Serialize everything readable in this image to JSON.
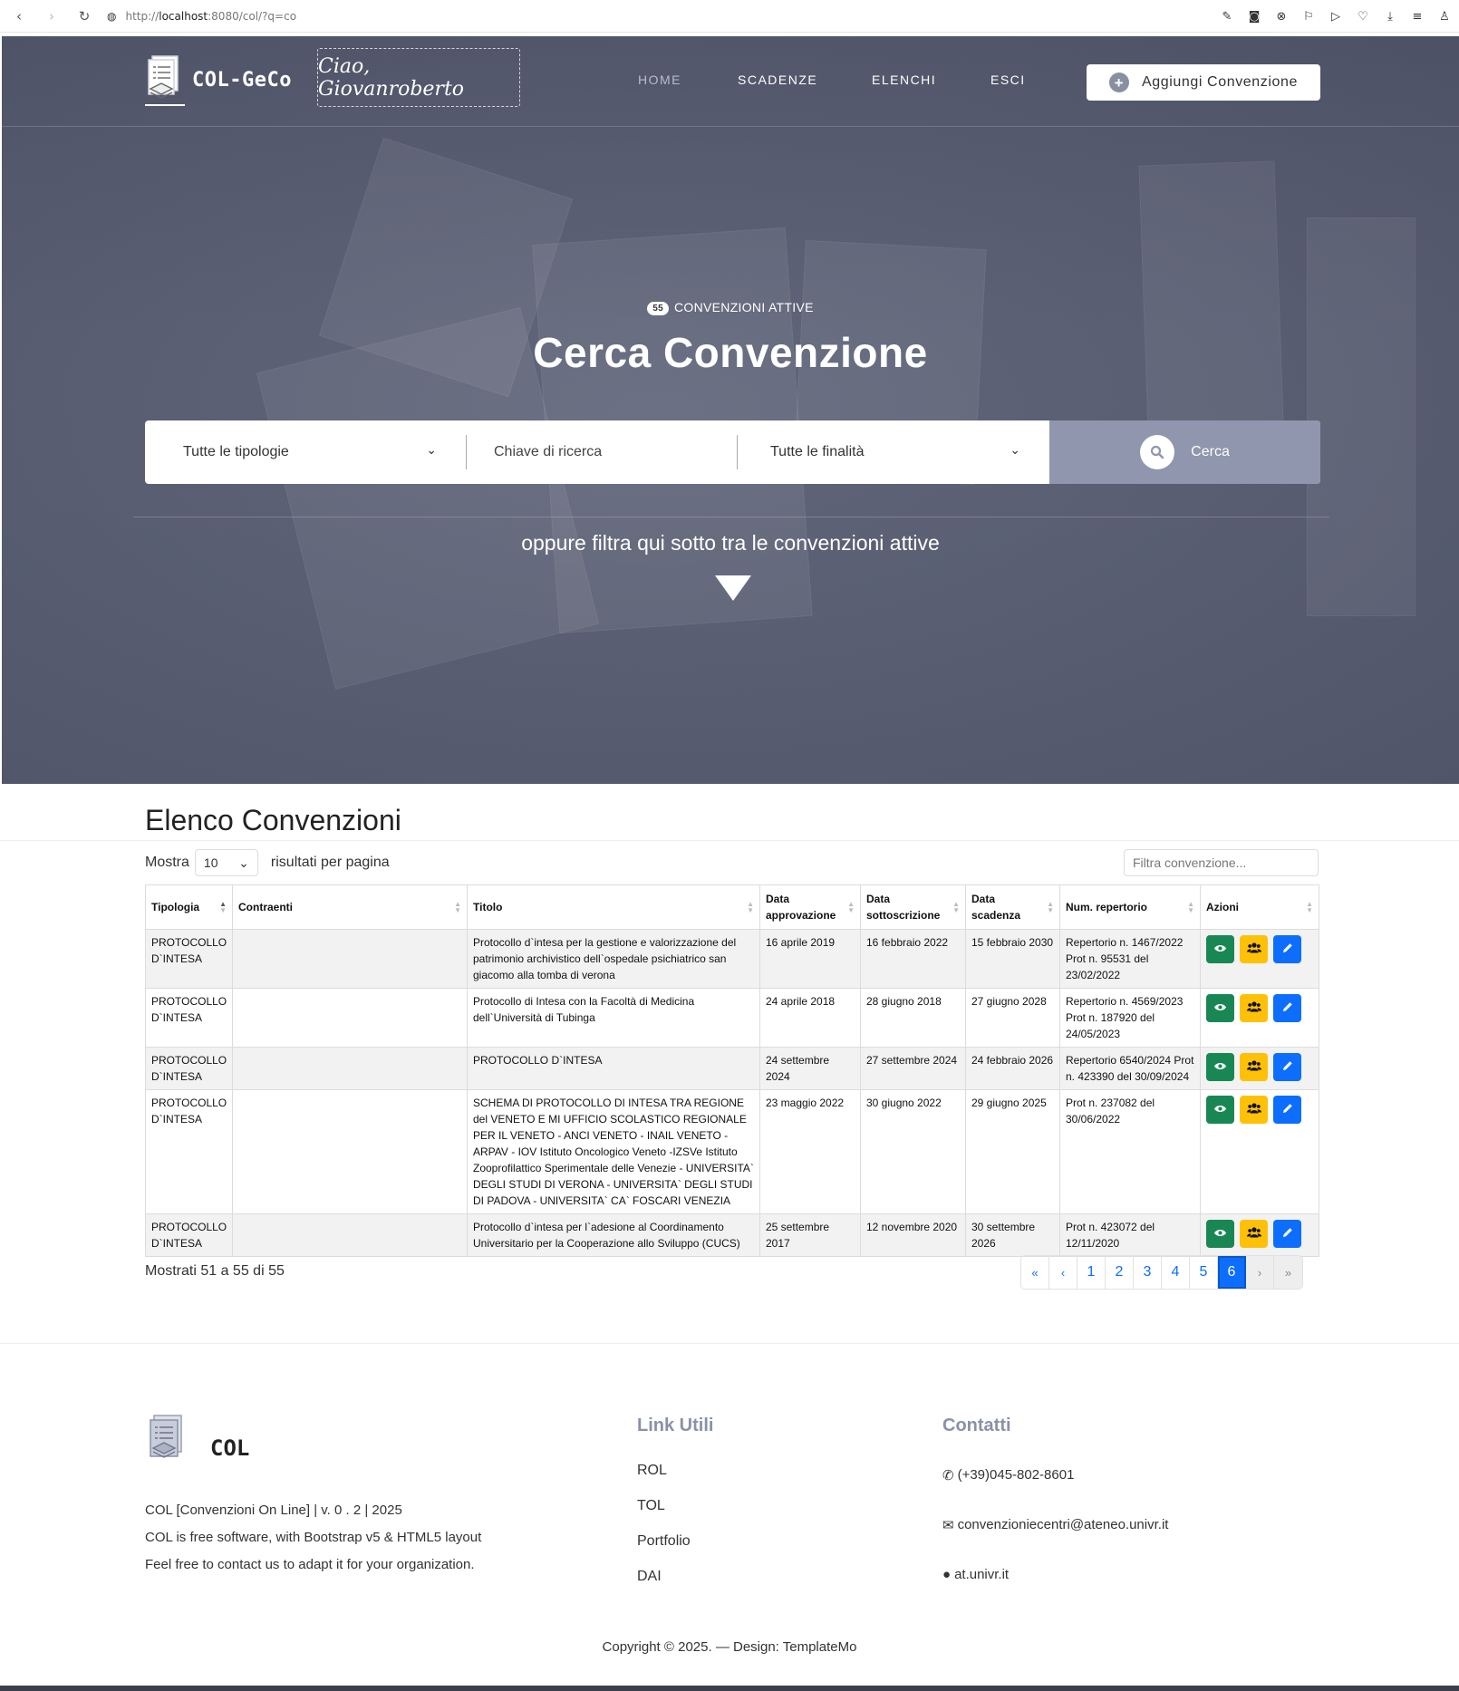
{
  "browser": {
    "url_prefix": "http://",
    "url_host": "localhost",
    "url_rest": ":8080/col/?q=co",
    "icons": [
      "back-icon",
      "forward-icon",
      "reload-icon",
      "site-info-icon"
    ]
  },
  "header": {
    "logo_text": "COL-GeCo",
    "greeting": "Ciao, Giovanroberto",
    "menu": [
      {
        "label": "HOME",
        "active": true
      },
      {
        "label": "SCADENZE",
        "active": false
      },
      {
        "label": "ELENCHI",
        "active": false
      },
      {
        "label": "ESCI",
        "active": false
      }
    ],
    "add_button": "Aggiungi Convenzione"
  },
  "hero": {
    "active_count": "55",
    "active_label": "CONVENZIONI ATTIVE",
    "title": "Cerca Convenzione",
    "search": {
      "type_select": "Tutte le tipologie",
      "keyword_placeholder": "Chiave di ricerca",
      "purpose_select": "Tutte le finalità",
      "button": "Cerca"
    },
    "subtitle": "oppure filtra qui sotto tra le convenzioni attive"
  },
  "list": {
    "title": "Elenco Convenzioni",
    "show_label": "Mostra",
    "page_length": "10",
    "per_page_label": "risultati per pagina",
    "filter_placeholder": "Filtra convenzione...",
    "columns": [
      "Tipologia",
      "Contraenti",
      "Titolo",
      "Data approvazione",
      "Data sottoscrizione",
      "Data scadenza",
      "Num. repertorio",
      "Azioni"
    ],
    "rows": [
      {
        "tipologia": "PROTOCOLLO D`INTESA",
        "contraenti": "",
        "titolo": "Protocollo d`intesa per la gestione e valorizzazione del patrimonio archivistico dell`ospedale psichiatrico san giacomo alla tomba di verona",
        "approvazione": "16 aprile 2019",
        "sottoscrizione": "16 febbraio 2022",
        "scadenza": "15 febbraio 2030",
        "repertorio": "Repertorio n. 1467/2022 Prot n. 95531 del 23/02/2022"
      },
      {
        "tipologia": "PROTOCOLLO D`INTESA",
        "contraenti": "",
        "titolo": "Protocollo di Intesa con la Facoltà di Medicina dell`Università di Tubinga",
        "approvazione": "24 aprile 2018",
        "sottoscrizione": "28 giugno 2018",
        "scadenza": "27 giugno 2028",
        "repertorio": "Repertorio n. 4569/2023 Prot n. 187920 del 24/05/2023"
      },
      {
        "tipologia": "PROTOCOLLO D`INTESA",
        "contraenti": "",
        "titolo": "PROTOCOLLO D`INTESA",
        "approvazione": "24 settembre 2024",
        "sottoscrizione": "27 settembre 2024",
        "scadenza": "24 febbraio 2026",
        "repertorio": "Repertorio 6540/2024 Prot n. 423390 del 30/09/2024"
      },
      {
        "tipologia": "PROTOCOLLO D`INTESA",
        "contraenti": "",
        "titolo": "SCHEMA DI PROTOCOLLO DI INTESA TRA REGIONE del VENETO E MI UFFICIO SCOLASTICO REGIONALE PER IL VENETO - ANCI VENETO - INAIL VENETO - ARPAV - IOV Istituto Oncologico Veneto -IZSVe Istituto Zooprofilattico Sperimentale delle Venezie - UNIVERSITA` DEGLI STUDI DI VERONA - UNIVERSITA` DEGLI STUDI DI PADOVA - UNIVERSITA` CA` FOSCARI VENEZIA",
        "approvazione": "23 maggio 2022",
        "sottoscrizione": "30 giugno 2022",
        "scadenza": "29 giugno 2025",
        "repertorio": "Prot n. 237082 del 30/06/2022"
      },
      {
        "tipologia": "PROTOCOLLO D`INTESA",
        "contraenti": "",
        "titolo": "Protocollo d`intesa per l`adesione al Coordinamento Universitario per la Cooperazione allo Sviluppo (CUCS)",
        "approvazione": "25 settembre 2017",
        "sottoscrizione": "12 novembre 2020",
        "scadenza": "30 settembre 2026",
        "repertorio": "Prot n. 423072 del 12/11/2020"
      }
    ],
    "action_icons": [
      "eye-icon",
      "users-icon",
      "pencil-icon"
    ],
    "shown_text": "Mostrati 51 a 55 di 55",
    "pagination": {
      "first": "«",
      "prev": "‹",
      "pages": [
        "1",
        "2",
        "3",
        "4",
        "5",
        "6"
      ],
      "current": "6",
      "next": "›",
      "last": "»"
    }
  },
  "footer": {
    "logo_text": "COL",
    "about": [
      "COL [Convenzioni On Line]  |  v. 0 . 2  |  2025",
      "COL is free software, with Bootstrap v5 & HTML5 layout",
      "Feel free to contact us to adapt it for your organization."
    ],
    "links_title": "Link Utili",
    "links": [
      "ROL",
      "TOL",
      "Portfolio",
      "DAI"
    ],
    "contacts_title": "Contatti",
    "contacts": [
      {
        "icon": "phone-icon",
        "text": "(+39)045-802-8601"
      },
      {
        "icon": "envelope-icon",
        "text": "convenzioniecentri@ateneo.univr.it"
      },
      {
        "icon": "globe-icon",
        "text": "at.univr.it"
      }
    ],
    "copyright": "Copyright © 2025. — Design: TemplateMo"
  },
  "colors": {
    "hero_bg": "#575c71",
    "search_button": "#8f96ad",
    "accent_title": "#8a91a8",
    "primary": "#0d6efd",
    "view": "#198754",
    "contraenti": "#ffc107"
  }
}
